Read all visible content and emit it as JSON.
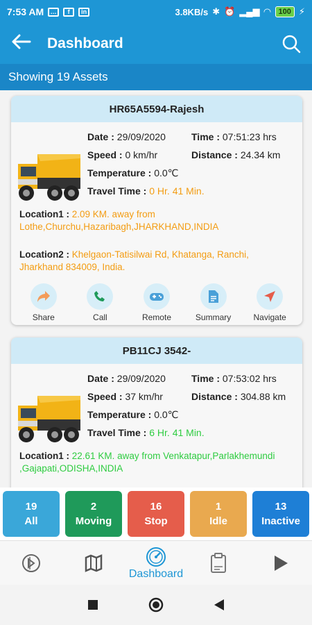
{
  "status_bar": {
    "time": "7:53 AM",
    "speed": "3.8KB/s",
    "battery": "100"
  },
  "header": {
    "title": "Dashboard"
  },
  "assets_label": "Showing 19 Assets",
  "labels": {
    "date": "Date :",
    "time": "Time :",
    "speed": "Speed :",
    "distance": "Distance :",
    "temperature": "Temperature :",
    "travel_time": "Travel Time :",
    "location1": "Location1 :",
    "location2": "Location2 :"
  },
  "actions": [
    "Share",
    "Call",
    "Remote",
    "Summary",
    "Navigate"
  ],
  "vehicles": [
    {
      "name": "HR65A5594-Rajesh",
      "date": "29/09/2020",
      "time": "07:51:23 hrs",
      "speed": "0  km/hr",
      "distance": "24.34 km",
      "temperature": "0.0℃",
      "travel_time": "0 Hr. 41 Min.",
      "location1": "2.09 KM. away from Lothe,Churchu,Hazaribagh,JHARKHAND,INDIA",
      "location2": "Khelgaon-Tatisilwai Rd, Khatanga, Ranchi, Jharkhand 834009, India."
    },
    {
      "name": "PB11CJ 3542-",
      "date": "29/09/2020",
      "time": "07:53:02 hrs",
      "speed": "37  km/hr",
      "distance": "304.88 km",
      "temperature": "0.0℃",
      "travel_time": "6 Hr. 41 Min.",
      "location1": "22.61 KM. away from Venkatapur,Parlakhemundi ,Gajapati,ODISHA,INDIA"
    }
  ],
  "filters": [
    {
      "count": "19",
      "label": "All",
      "color": "#3aa7d9"
    },
    {
      "count": "2",
      "label": "Moving",
      "color": "#1f9a5a"
    },
    {
      "count": "16",
      "label": "Stop",
      "color": "#e55d4b"
    },
    {
      "count": "1",
      "label": "Idle",
      "color": "#e9a94f"
    },
    {
      "count": "13",
      "label": "Inactive",
      "color": "#1e7fd6"
    }
  ],
  "bottom_nav": {
    "active_label": "Dashboard",
    "icons": [
      "playback-icon",
      "map-icon",
      "dashboard-icon",
      "report-icon",
      "play-icon"
    ]
  },
  "colors": {
    "primary": "#1e96d5",
    "orange_value": "#f39c12",
    "green_value": "#2ecc40"
  }
}
